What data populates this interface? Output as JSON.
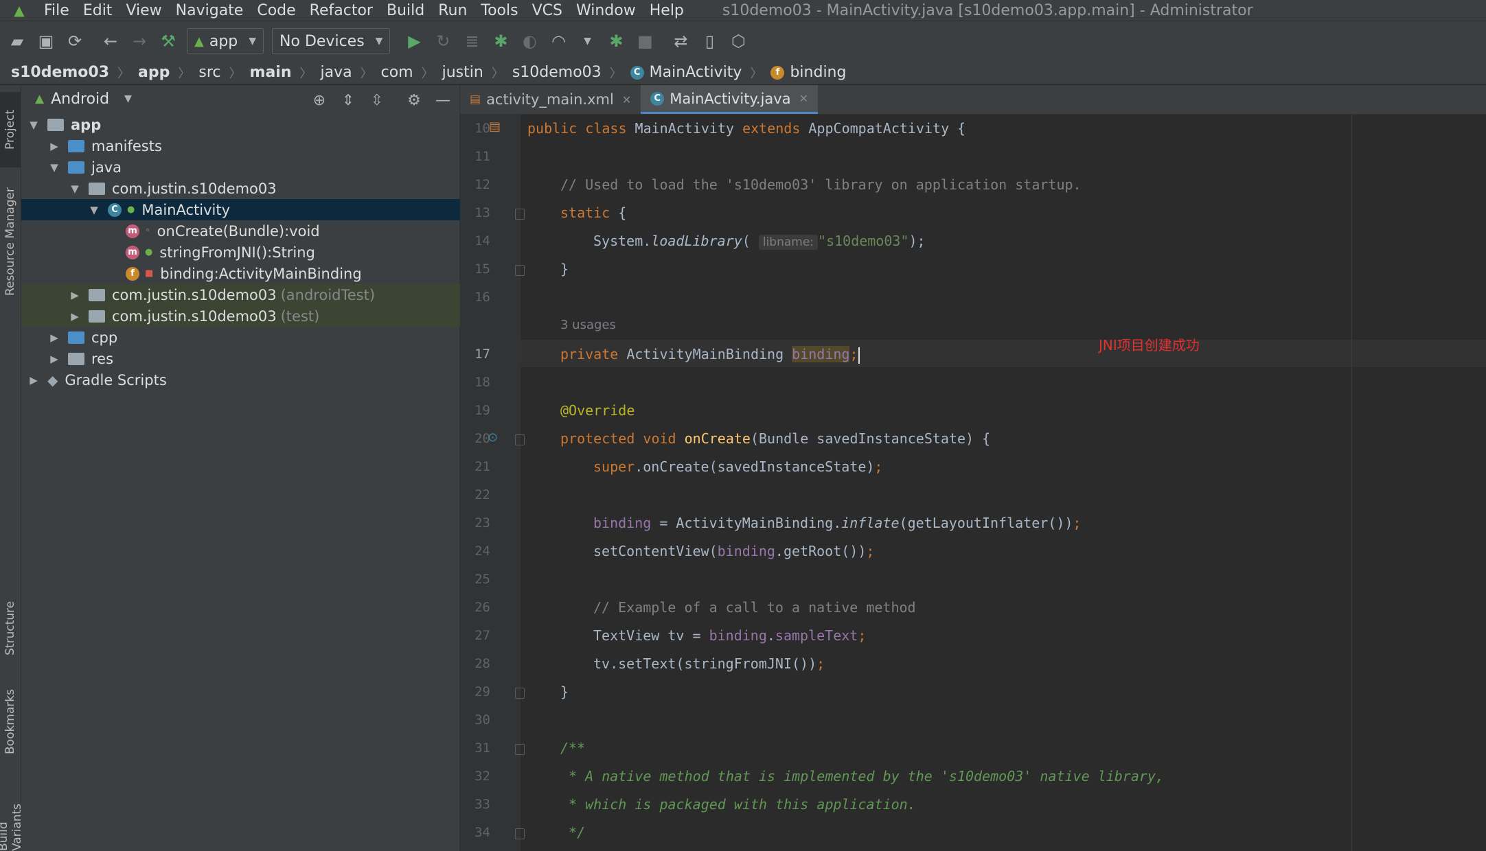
{
  "menu": {
    "items": [
      "File",
      "Edit",
      "View",
      "Navigate",
      "Code",
      "Refactor",
      "Build",
      "Run",
      "Tools",
      "VCS",
      "Window",
      "Help"
    ],
    "title": "s10demo03 - MainActivity.java [s10demo03.app.main] - Administrator"
  },
  "toolbar": {
    "config": "app",
    "device": "No Devices"
  },
  "breadcrumb": [
    "s10demo03",
    "app",
    "src",
    "main",
    "java",
    "com",
    "justin",
    "s10demo03",
    "MainActivity",
    "binding"
  ],
  "sidebar": {
    "project_tab": "Project",
    "resource_tab": "Resource Manager",
    "structure_tab": "Structure",
    "bookmarks_tab": "Bookmarks",
    "build_variants_tab": "Build Variants"
  },
  "project": {
    "view": "Android",
    "tree": [
      {
        "label": "app",
        "muted": ""
      },
      {
        "label": "manifests",
        "muted": ""
      },
      {
        "label": "java",
        "muted": ""
      },
      {
        "label": "com.justin.s10demo03",
        "muted": ""
      },
      {
        "label": "MainActivity",
        "muted": ""
      },
      {
        "label": "onCreate(Bundle):void",
        "muted": ""
      },
      {
        "label": "stringFromJNI():String",
        "muted": ""
      },
      {
        "label": "binding:ActivityMainBinding",
        "muted": ""
      },
      {
        "label": "com.justin.s10demo03",
        "muted": "(androidTest)"
      },
      {
        "label": "com.justin.s10demo03",
        "muted": "(test)"
      },
      {
        "label": "cpp",
        "muted": ""
      },
      {
        "label": "res",
        "muted": ""
      },
      {
        "label": "Gradle Scripts",
        "muted": ""
      }
    ]
  },
  "editor": {
    "tabs": [
      "activity_main.xml",
      "MainActivity.java"
    ],
    "line_numbers": [
      "10",
      "11",
      "12",
      "13",
      "14",
      "15",
      "16",
      "17",
      "18",
      "19",
      "20",
      "21",
      "22",
      "23",
      "24",
      "25",
      "26",
      "27",
      "28",
      "29",
      "30",
      "31",
      "32",
      "33",
      "34"
    ],
    "code": {
      "l10_a": "public class ",
      "l10_b": "MainActivity ",
      "l10_c": "extends ",
      "l10_d": "AppCompatActivity {",
      "l12": "// Used to load the 's10demo03' library on application startup.",
      "l13_a": "static ",
      "l13_b": "{",
      "l14_a": "System.",
      "l14_b": "loadLibrary",
      "l14_c": "( ",
      "l14_hint": "libname:",
      "l14_d": "\"s10demo03\"",
      "l14_e": ");",
      "l15": "}",
      "usages": "3 usages",
      "l17_a": "private ",
      "l17_b": "ActivityMainBinding ",
      "l17_c": "binding",
      "l17_d": ";",
      "l19": "@Override",
      "l20_a": "protected void ",
      "l20_b": "onCreate",
      "l20_c": "(Bundle savedInstanceState) {",
      "l21_a": "super",
      "l21_b": ".onCreate(savedInstanceState)",
      "l21_c": ";",
      "l23_a": "binding",
      "l23_b": " = ActivityMainBinding.",
      "l23_c": "inflate",
      "l23_d": "(getLayoutInflater())",
      "l23_e": ";",
      "l24_a": "setContentView(",
      "l24_b": "binding",
      "l24_c": ".getRoot())",
      "l24_d": ";",
      "l26": "// Example of a call to a native method",
      "l27_a": "TextView tv = ",
      "l27_b": "binding",
      "l27_c": ".",
      "l27_d": "sampleText",
      "l27_e": ";",
      "l28_a": "tv.setText(stringFromJNI())",
      "l28_b": ";",
      "l29": "}",
      "l31": "/**",
      "l32": " * A native method that is implemented by the 's10demo03' native library,",
      "l33": " * which is packaged with this application.",
      "l34": " */"
    },
    "annotation": "JNI项目创建成功"
  },
  "colors": {
    "accent": "#4a88c7",
    "keyword": "#cc7832",
    "string": "#6a8759",
    "field": "#9876aa",
    "annotation_text": "#e03030"
  }
}
